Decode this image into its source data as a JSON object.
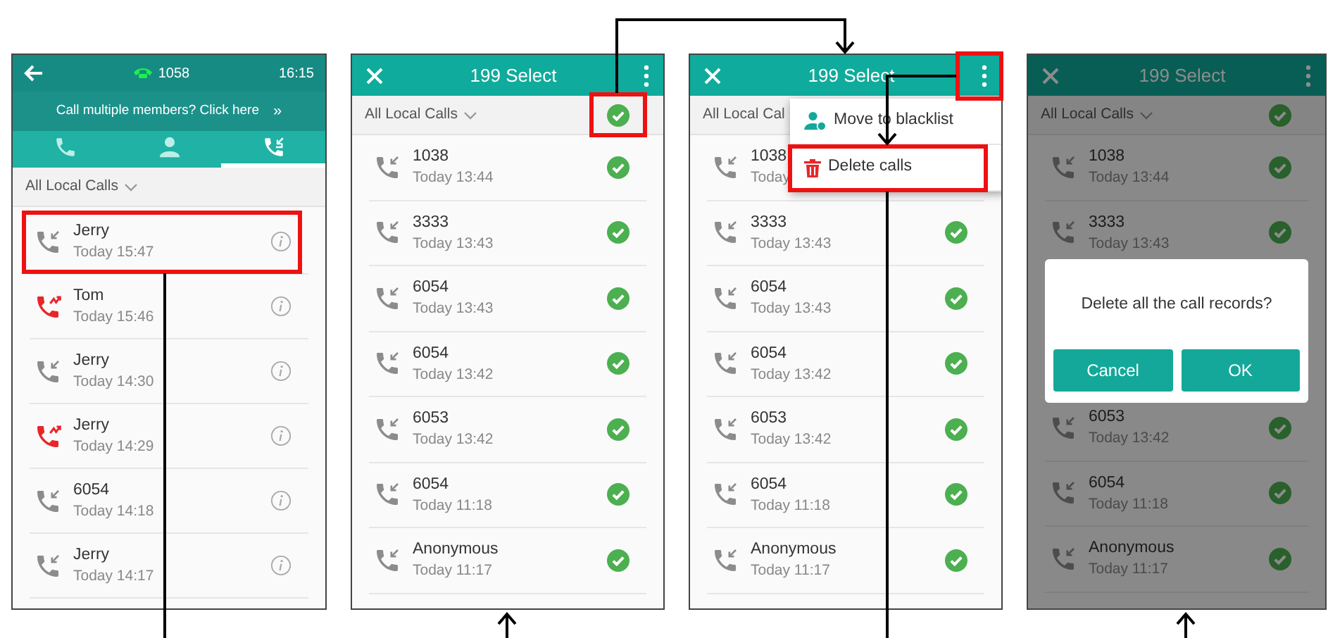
{
  "screen_1": {
    "status_bar": {
      "account": "1058",
      "time": "16:15"
    },
    "banner": {
      "text": "Call multiple members? Click here",
      "arrow": "»"
    },
    "tabs": [
      {
        "selected": false
      },
      {
        "selected": false
      },
      {
        "selected": true
      }
    ],
    "filter": "All Local Calls",
    "rows": [
      {
        "name": "Jerry",
        "time": "Today 15:47",
        "kind": "received"
      },
      {
        "name": "Tom",
        "time": "Today 15:46",
        "kind": "missed"
      },
      {
        "name": "Jerry",
        "time": "Today 14:30",
        "kind": "received"
      },
      {
        "name": "Jerry",
        "time": "Today 14:29",
        "kind": "missed"
      },
      {
        "name": "6054",
        "time": "Today 14:18",
        "kind": "received"
      },
      {
        "name": "Jerry",
        "time": "Today 14:17",
        "kind": "received"
      }
    ]
  },
  "screen_2": {
    "title": "199 Select",
    "filter": "All Local Calls",
    "all_checked": true,
    "rows": [
      {
        "name": "1038",
        "time": "Today 13:44",
        "checked": true
      },
      {
        "name": "3333",
        "time": "Today 13:43",
        "checked": true
      },
      {
        "name": "6054",
        "time": "Today 13:43",
        "checked": true
      },
      {
        "name": "6054",
        "time": "Today 13:42",
        "checked": true
      },
      {
        "name": "6053",
        "time": "Today 13:42",
        "checked": true
      },
      {
        "name": "6054",
        "time": "Today 11:18",
        "checked": true
      },
      {
        "name": "Anonymous",
        "time": "Today 11:17",
        "checked": true
      }
    ]
  },
  "screen_3": {
    "title": "199 Select",
    "filter": "All Local Cal",
    "rows": [
      {
        "name": "1038",
        "time": "Today"
      },
      {
        "name": "3333",
        "time": "Today 13:43",
        "checked": true
      },
      {
        "name": "6054",
        "time": "Today 13:43",
        "checked": true
      },
      {
        "name": "6054",
        "time": "Today 13:42",
        "checked": true
      },
      {
        "name": "6053",
        "time": "Today 13:42",
        "checked": true
      },
      {
        "name": "6054",
        "time": "Today 11:18",
        "checked": true
      },
      {
        "name": "Anonymous",
        "time": "Today 11:17",
        "checked": true
      }
    ],
    "menu": [
      {
        "kind": "blacklist",
        "label": "Move to blacklist"
      },
      {
        "kind": "delete",
        "label": "Delete calls"
      }
    ]
  },
  "screen_4": {
    "title": "199 Select",
    "filter": "All Local Calls",
    "all_checked": true,
    "rows_above": [
      {
        "name": "1038",
        "time": "Today 13:44",
        "checked": true
      },
      {
        "name": "3333",
        "time": "Today 13:43",
        "checked": true
      }
    ],
    "dialog": {
      "message": "Delete all the call records?",
      "buttons": [
        "Cancel",
        "OK"
      ]
    },
    "rows_below": [
      {
        "name": "6053",
        "time": "Today 13:42",
        "checked": true
      },
      {
        "name": "6054",
        "time": "Today 11:18",
        "checked": true
      },
      {
        "name": "Anonymous",
        "time": "Today 11:17",
        "checked": true
      }
    ]
  }
}
